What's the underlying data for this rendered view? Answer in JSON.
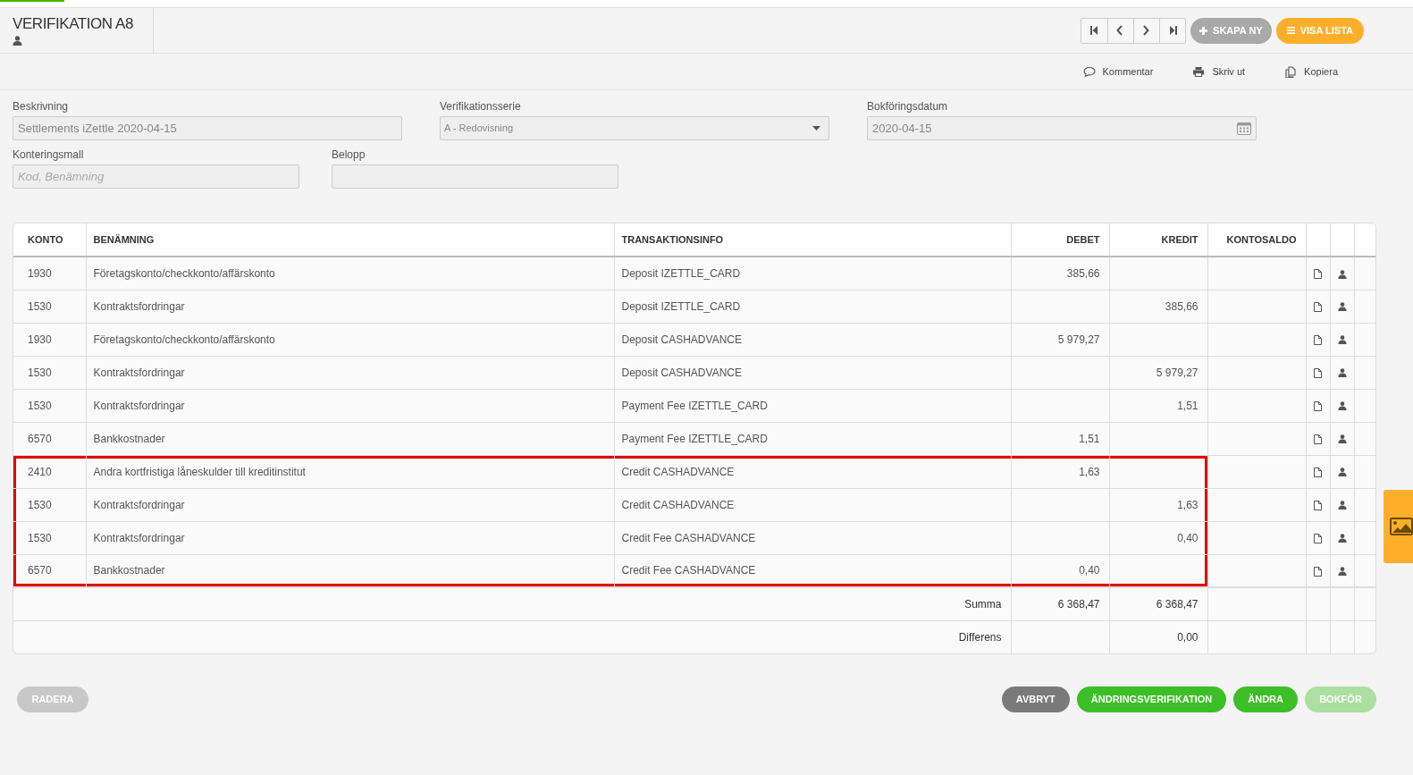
{
  "header": {
    "title": "VERIFIKATION A8",
    "create_button": "SKAPA NY",
    "list_button": "VISA LISTA"
  },
  "actions": [
    {
      "kind": "comment",
      "label": "Kommentar"
    },
    {
      "kind": "print",
      "label": "Skriv ut"
    },
    {
      "kind": "copy",
      "label": "Kopiera"
    }
  ],
  "form": {
    "description": {
      "label": "Beskrivning",
      "value": "Settlements iZettle 2020-04-15"
    },
    "series": {
      "label": "Verifikationsserie",
      "value": "A - Redovisning"
    },
    "date": {
      "label": "Bokföringsdatum",
      "value": "2020-04-15"
    },
    "template": {
      "label": "Konteringsmall",
      "placeholder": "Kod, Benämning"
    },
    "amount": {
      "label": "Belopp"
    }
  },
  "table": {
    "columns": [
      "KONTO",
      "BENÄMNING",
      "TRANSAKTIONSINFO",
      "DEBET",
      "KREDIT",
      "KONTOSALDO"
    ],
    "rows": [
      {
        "account": "1930",
        "name": "Företagskonto/checkkonto/affärskonto",
        "info": "Deposit IZETTLE_CARD",
        "debit": "385,66",
        "credit": "",
        "highlighted": false
      },
      {
        "account": "1530",
        "name": "Kontraktsfordringar",
        "info": "Deposit IZETTLE_CARD",
        "debit": "",
        "credit": "385,66",
        "highlighted": false
      },
      {
        "account": "1930",
        "name": "Företagskonto/checkkonto/affärskonto",
        "info": "Deposit CASHADVANCE",
        "debit": "5 979,27",
        "credit": "",
        "highlighted": false
      },
      {
        "account": "1530",
        "name": "Kontraktsfordringar",
        "info": "Deposit CASHADVANCE",
        "debit": "",
        "credit": "5 979,27",
        "highlighted": false
      },
      {
        "account": "1530",
        "name": "Kontraktsfordringar",
        "info": "Payment Fee IZETTLE_CARD",
        "debit": "",
        "credit": "1,51",
        "highlighted": false
      },
      {
        "account": "6570",
        "name": "Bankkostnader",
        "info": "Payment Fee IZETTLE_CARD",
        "debit": "1,51",
        "credit": "",
        "highlighted": false
      },
      {
        "account": "2410",
        "name": "Andra kortfristiga låneskulder till kreditinstitut",
        "info": "Credit CASHADVANCE",
        "debit": "1,63",
        "credit": "",
        "highlighted": true
      },
      {
        "account": "1530",
        "name": "Kontraktsfordringar",
        "info": "Credit CASHADVANCE",
        "debit": "",
        "credit": "1,63",
        "highlighted": true
      },
      {
        "account": "1530",
        "name": "Kontraktsfordringar",
        "info": "Credit Fee CASHADVANCE",
        "debit": "",
        "credit": "0,40",
        "highlighted": true
      },
      {
        "account": "6570",
        "name": "Bankkostnader",
        "info": "Credit Fee CASHADVANCE",
        "debit": "0,40",
        "credit": "",
        "highlighted": true
      }
    ],
    "totals": [
      {
        "label": "Summa",
        "debit": "6 368,47",
        "credit": "6 368,47"
      },
      {
        "label": "Differens",
        "credit": "0,00"
      }
    ]
  },
  "footer_buttons": [
    {
      "kind": "delete",
      "label": "RADERA",
      "disabled": true
    },
    {
      "kind": "cancel",
      "label": "AVBRYT",
      "disabled": false
    },
    {
      "kind": "green",
      "label": "ÄNDRINGSVERIFIKATION",
      "disabled": false
    },
    {
      "kind": "green",
      "label": "ÄNDRA",
      "disabled": false
    },
    {
      "kind": "green",
      "label": "BOKFÖR",
      "disabled": true
    }
  ]
}
